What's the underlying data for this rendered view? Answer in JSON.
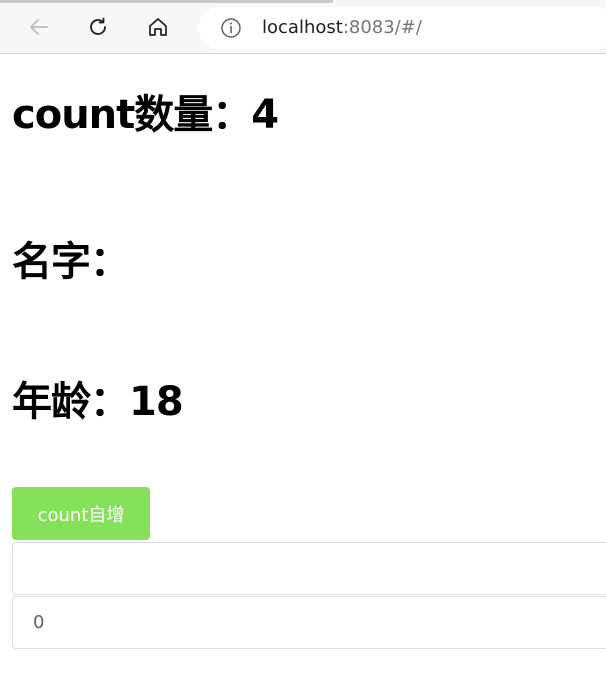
{
  "browser": {
    "url_host": "localhost",
    "url_rest": ":8083/#/",
    "icons": {
      "back": "arrow-left-icon",
      "reload": "reload-icon",
      "home": "home-icon",
      "info": "info-icon"
    }
  },
  "page": {
    "count_heading": "count数量：4",
    "name_heading": "名字：",
    "age_heading": "年龄：18",
    "increment_button": "count自增",
    "name_input_value": "",
    "count_input_value": "0"
  },
  "colors": {
    "button_bg": "#85e05a",
    "button_text": "#ffffff",
    "input_border": "#dcdfe6"
  }
}
